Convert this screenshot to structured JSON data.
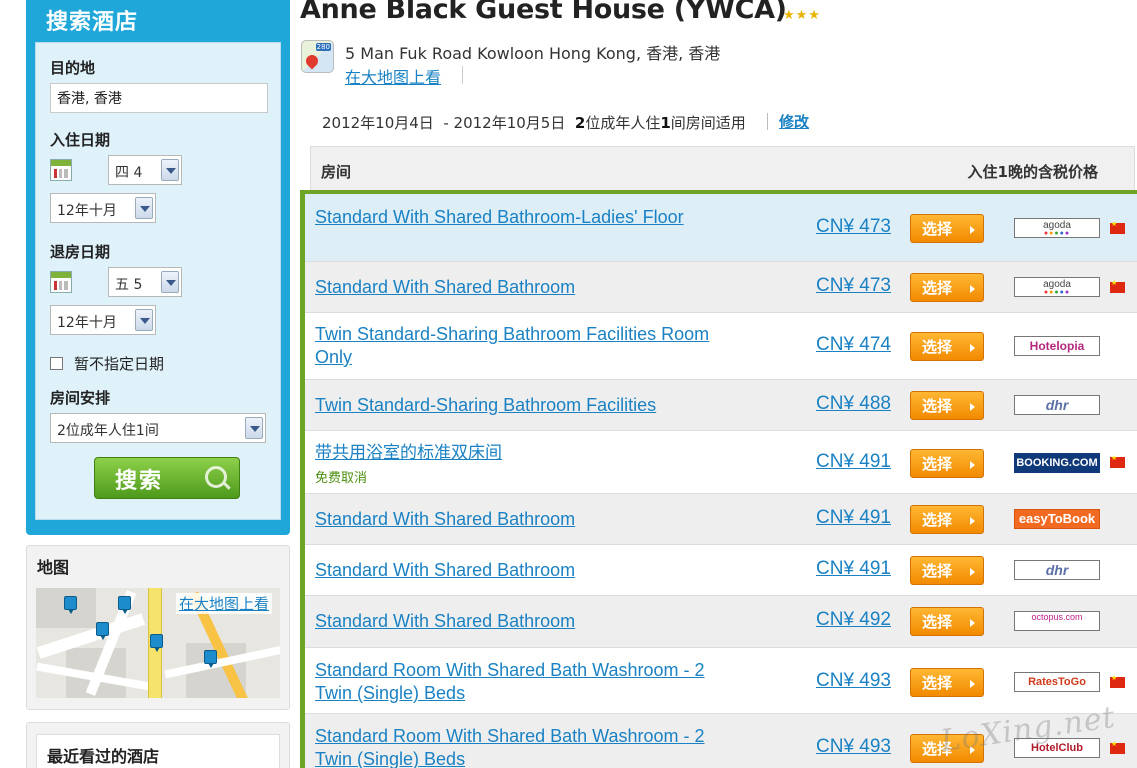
{
  "search": {
    "title": "搜索酒店",
    "destination_label": "目的地",
    "destination_value": "香港, 香港",
    "checkin_label": "入住日期",
    "checkin_day": "四 4",
    "checkin_month": "12年十月",
    "checkout_label": "退房日期",
    "checkout_day": "五 5",
    "checkout_month": "12年十月",
    "no_date_label": "暂不指定日期",
    "rooms_label": "房间安排",
    "rooms_value": "2位成年人住1间",
    "search_button": "搜索"
  },
  "map": {
    "title": "地图",
    "large_map_link": "在大地图上看"
  },
  "recent": {
    "title": "最近看过的酒店"
  },
  "hotel": {
    "name": "Anne Black Guest House (YWCA)",
    "stars": "★★★",
    "address": "5 Man Fuk Road Kowloon Hong Kong, 香港, 香港",
    "map_link": "在大地图上看"
  },
  "stay": {
    "checkin": "2012年10月4日",
    "checkout": "- 2012年10月5日",
    "guests_count": "2",
    "guests_text": "位成年人住",
    "rooms_count": "1",
    "rooms_text": "间房间适用",
    "modify_link": "修改"
  },
  "table": {
    "room_header": "房间",
    "price_header": "入住1晚的含税价格",
    "select_label": "选择",
    "rows": [
      {
        "room": "Standard With Shared Bathroom-Ladies' Floor",
        "price": "CN¥ 473",
        "provider": "agoda",
        "flag": true
      },
      {
        "room": "Standard With Shared Bathroom",
        "price": "CN¥ 473",
        "provider": "agoda",
        "flag": true
      },
      {
        "room": "Twin Standard-Sharing Bathroom Facilities Room Only",
        "price": "CN¥ 474",
        "provider": "Hotelopia",
        "flag": false
      },
      {
        "room": "Twin Standard-Sharing Bathroom Facilities",
        "price": "CN¥ 488",
        "provider": "dhr",
        "flag": false
      },
      {
        "room": "带共用浴室的标准双床间",
        "note": "免费取消",
        "price": "CN¥ 491",
        "provider": "BOOKING.COM",
        "flag": true
      },
      {
        "room": "Standard With Shared Bathroom",
        "price": "CN¥ 491",
        "provider": "easyToBook",
        "flag": false
      },
      {
        "room": "Standard With Shared Bathroom",
        "price": "CN¥ 491",
        "provider": "dhr",
        "flag": false
      },
      {
        "room": "Standard With Shared Bathroom",
        "price": "CN¥ 492",
        "provider": "octopus.com",
        "flag": false
      },
      {
        "room": "Standard Room With Shared Bath Washroom - 2 Twin (Single) Beds",
        "price": "CN¥ 493",
        "provider": "RatesToGo",
        "flag": true
      },
      {
        "room": "Standard Room With Shared Bath Washroom - 2 Twin (Single) Beds",
        "price": "CN¥ 493",
        "provider": "HotelClub",
        "flag": true
      }
    ]
  },
  "watermark": "LoXing.net",
  "colors": {
    "panel_blue": "#1fa7d9",
    "link_blue": "#1a82c4",
    "accent_green": "#6fa527",
    "select_orange": "#f28a00"
  }
}
